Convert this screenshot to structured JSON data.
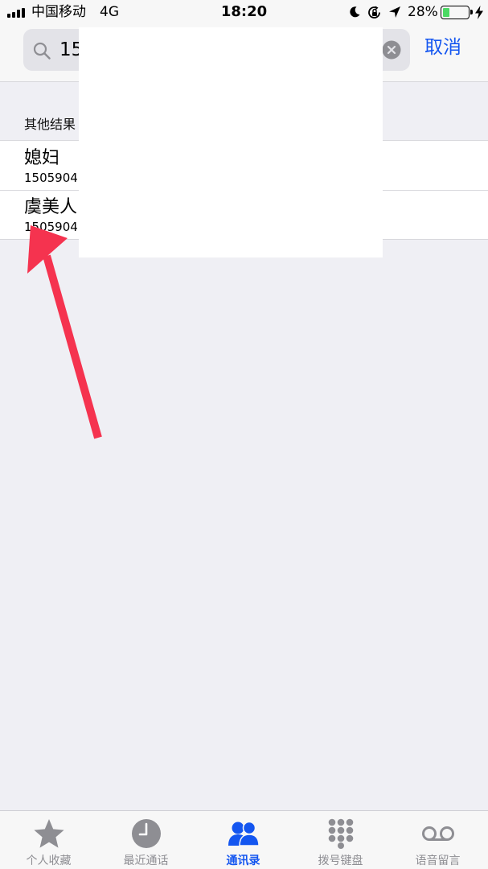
{
  "status_bar": {
    "carrier": "中国移动",
    "network": "4G",
    "time": "18:20",
    "battery_percent": "28%",
    "battery_level": 0.28,
    "battery_fill_color": "#4cd964",
    "icons": [
      "signal-icon",
      "moon-icon",
      "orientation-lock-icon",
      "location-icon",
      "battery-icon",
      "charging-bolt-icon"
    ]
  },
  "search": {
    "query": "15",
    "cancel_label": "取消",
    "icon": "search-icon",
    "clear_icon": "clear-icon"
  },
  "results": {
    "section_title": "其他结果",
    "items": [
      {
        "name": "媳妇",
        "number": "1505904"
      },
      {
        "name": "虞美人",
        "number": "1505904"
      }
    ]
  },
  "tabs": [
    {
      "label": "个人收藏",
      "icon": "star-icon",
      "active": false
    },
    {
      "label": "最近通话",
      "icon": "clock-icon",
      "active": false
    },
    {
      "label": "通讯录",
      "icon": "contacts-icon",
      "active": true
    },
    {
      "label": "拨号键盘",
      "icon": "keypad-icon",
      "active": false
    },
    {
      "label": "语音留言",
      "icon": "voicemail-icon",
      "active": false
    }
  ],
  "colors": {
    "accent": "#1456f0",
    "annotation_arrow": "#f5334f",
    "background": "#efeff4"
  }
}
